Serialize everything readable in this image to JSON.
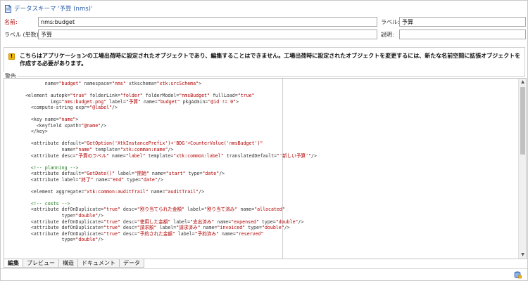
{
  "window": {
    "title": "データスキーマ '予算 (nms)'",
    "icon": "document-icon"
  },
  "form": {
    "name_label": "名前:",
    "name_value": "nms:budget",
    "label_label": "ラベル:",
    "label_value": "予算",
    "label_singular_label": "ラベル (単数):",
    "label_singular_value": "予算",
    "description_label": "説明:",
    "description_value": ""
  },
  "warning": {
    "icon": "warning-icon",
    "text": "こちらはアプリケーションの工場出荷時に設定されたオブジェクトであり、編集することはできません。工場出荷時に設定されたオブジェクトを変更するには、新たな名前空間に拡張オブジェクトを作成する必要があります。",
    "section_label": "警告"
  },
  "editor": {
    "lines": [
      "         name=\"budget\" namespace=\"nms\" xtkschema=\"xtk:srcSchema\">",
      "",
      "  <element autopk=\"true\" folderLink=\"folder\" folderModel=\"nmsBudget\" fullLoad=\"true\"",
      "           img=\"nms:budget.png\" label=\"予算\" name=\"budget\" pkgAdmin=\"@id != 0\">",
      "    <compute-string expr=\"@label\"/>",
      "",
      "    <key name=\"name\">",
      "      <keyfield xpath=\"@name\"/>",
      "    </key>",
      "",
      "    <attribute default=\"GetOption('XtkInstancePrefix')+'BDG'+CounterValue('nmsBudget')\"",
      "               name=\"name\" template=\"xtk:common:name\"/>",
      "    <attribute desc=\"予算のラベル\" name=\"label\" template=\"xtk:common:label\" translatedDefault=\"'新しい予算'\"/>",
      "",
      "    <!-- planning -->",
      "    <attribute default=\"GetDate()\" label=\"開始\" name=\"start\" type=\"date\"/>",
      "    <attribute label=\"終了\" name=\"end\" type=\"date\"/>",
      "",
      "    <element aggregate=\"xtk:common:auditTrail\" name=\"auditTrail\"/>",
      "",
      "    <!-- costs -->",
      "    <attribute defOnDuplicate=\"true\" desc=\"割り当てられた金額\" label=\"割り当て済み\" name=\"allocated\"",
      "               type=\"double\"/>",
      "    <attribute defOnDuplicate=\"true\" desc=\"使用した金額\" label=\"支出済み\" name=\"expensed\" type=\"double\"/>",
      "    <attribute defOnDuplicate=\"true\" desc=\"請求額\" label=\"請求済み\" name=\"invoiced\" type=\"double\"/>",
      "    <attribute defOnDuplicate=\"true\" desc=\"予約された金額\" label=\"予約済み\" name=\"reserved\"",
      "               type=\"double\"/>"
    ]
  },
  "tabs": [
    "編集",
    "プレビュー",
    "構造",
    "ドキュメント",
    "データ"
  ],
  "active_tab": "編集",
  "colors": {
    "title": "#2a5da8",
    "required_label": "#b00000",
    "xml_value": "#b00000",
    "xml_comment": "#1c7a1c",
    "warning": "#f2b705"
  }
}
